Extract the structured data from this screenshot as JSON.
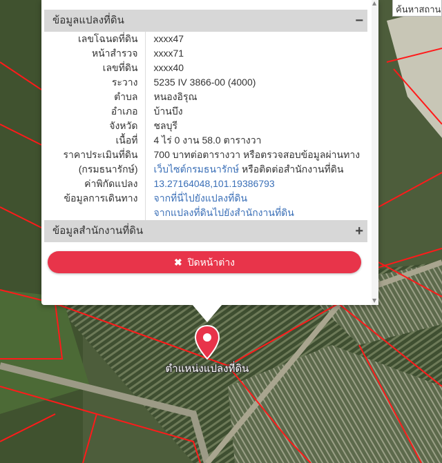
{
  "search": {
    "placeholder": "ค้นหาสถานที่"
  },
  "popup": {
    "section1_title": "ข้อมูลแปลงที่ดิน",
    "section1_toggle": "−",
    "rows": [
      {
        "label": "เลขโฉนดที่ดิน",
        "value": "xxxx47"
      },
      {
        "label": "หน้าสำรวจ",
        "value": "xxxx71"
      },
      {
        "label": "เลขที่ดิน",
        "value": "xxxx40"
      },
      {
        "label": "ระวาง",
        "value": "5235 IV 3866-00 (4000)"
      },
      {
        "label": "ตำบล",
        "value": "หนองอิรุณ"
      },
      {
        "label": "อำเภอ",
        "value": "บ้านบึง"
      },
      {
        "label": "จังหวัด",
        "value": "ชลบุรี"
      },
      {
        "label": "เนื้อที่",
        "value": "4 ไร่ 0 งาน 58.0 ตารางวา"
      }
    ],
    "price_label": "ราคาประเมินที่ดิน",
    "price_value": "700 บาทต่อตารางวา หรือตรวจสอบข้อมูลผ่านทาง",
    "dept_label": "(กรมธนารักษ์)",
    "dept_link": "เว็บไซต์กรมธนารักษ์",
    "dept_suffix": " หรือติดต่อสำนักงานที่ดิน",
    "coord_label": "ค่าพิกัดแปลง",
    "coord_value": "13.27164048,101.19386793",
    "travel_label": "ข้อมูลการเดินทาง",
    "travel_link1": "จากที่นี่ไปยังแปลงที่ดิน",
    "travel_link2": "จากแปลงที่ดินไปยังสำนักงานที่ดิน",
    "section2_title": "ข้อมูลสำนักงานที่ดิน",
    "section2_toggle": "+",
    "close_icon": "✖",
    "close_label": "ปิดหน้าต่าง"
  },
  "marker": {
    "label": "ตำแหน่งแปลงที่ดิน",
    "color": "#e8344a"
  },
  "colors": {
    "accent": "#e8344a",
    "link": "#3a6fb7",
    "header_bg": "#d7d7d7",
    "parcel_line": "#ff1a1a"
  }
}
